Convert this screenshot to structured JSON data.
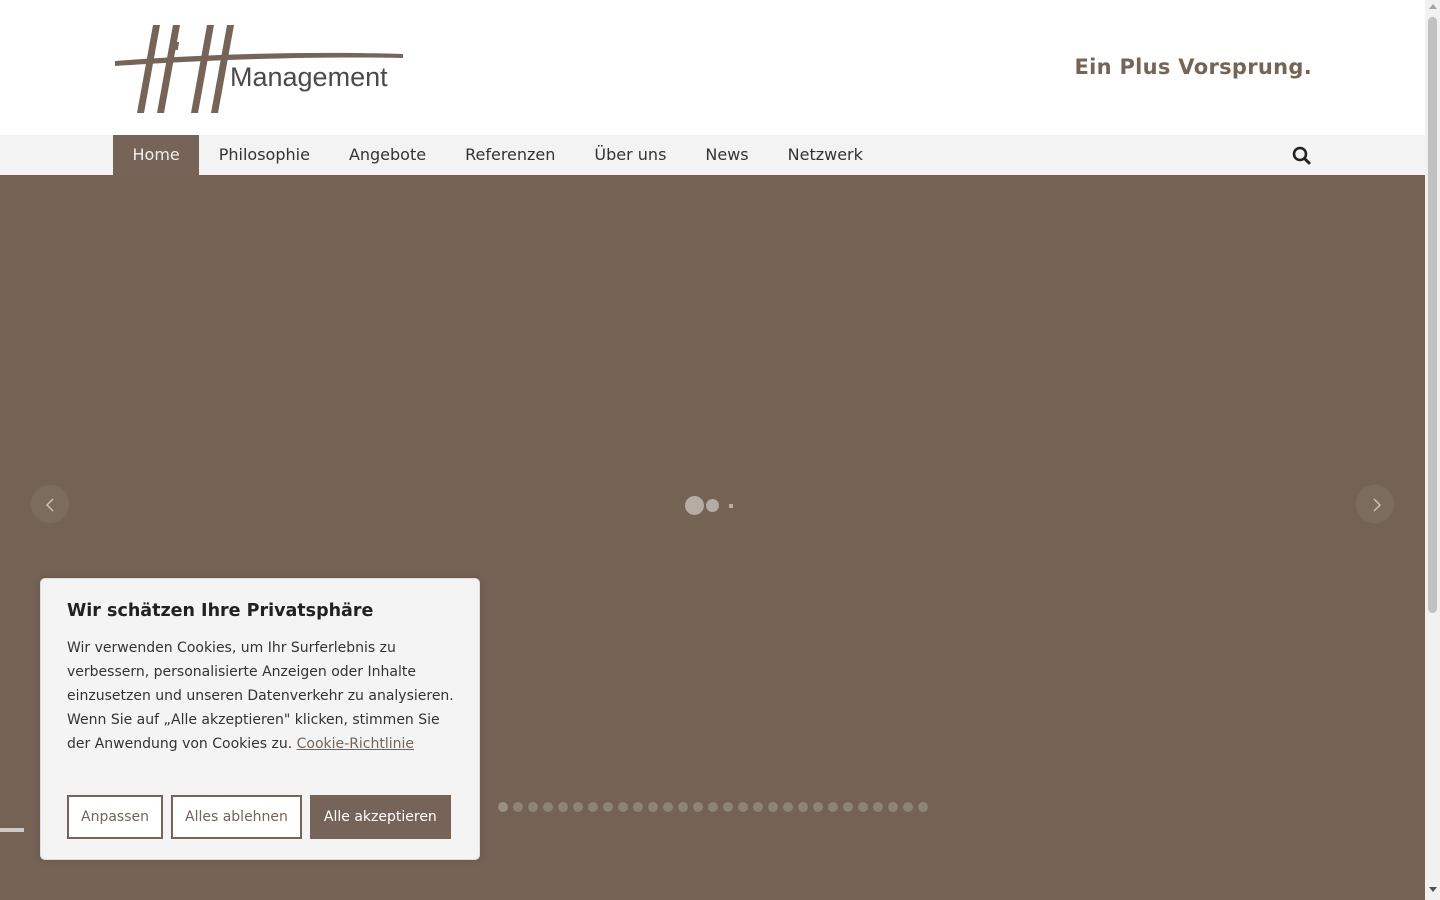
{
  "header": {
    "logo_text": "Management",
    "tagline": "Ein Plus Vorsprung."
  },
  "nav": {
    "items": [
      {
        "label": "Home",
        "active": true
      },
      {
        "label": "Philosophie"
      },
      {
        "label": "Angebote"
      },
      {
        "label": "Referenzen"
      },
      {
        "label": "Über uns"
      },
      {
        "label": "News"
      },
      {
        "label": "Netzwerk"
      }
    ],
    "search_icon": "search-icon"
  },
  "slider": {
    "background_color": "#746354",
    "prev_icon": "chevron-left-icon",
    "next_icon": "chevron-right-icon",
    "dot_count": 29,
    "active_dot": 0
  },
  "cookie": {
    "title": "Wir schätzen Ihre Privatsphäre",
    "text": "Wir verwenden Cookies, um Ihr Surferlebnis zu verbessern, personalisierte Anzeigen oder Inhalte einzusetzen und unseren Datenverkehr zu analysieren. Wenn Sie auf „Alle akzeptieren\" klicken, stimmen Sie der Anwendung von Cookies zu.",
    "link_label": "Cookie-Richtlinie",
    "buttons": {
      "customize": "Anpassen",
      "reject": "Alles ablehnen",
      "accept": "Alle akzeptieren"
    }
  },
  "colors": {
    "brand": "#756457",
    "nav_bg": "#f3f3f3"
  }
}
